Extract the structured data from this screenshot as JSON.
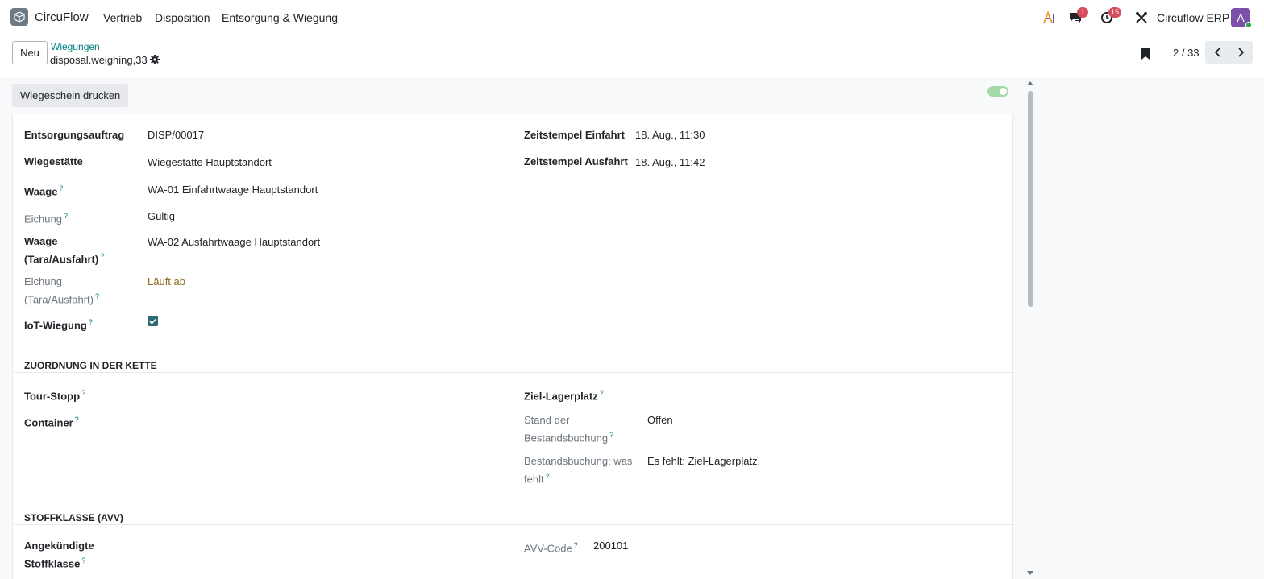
{
  "nav": {
    "app_name": "CircuFlow",
    "menu": [
      "Vertrieb",
      "Disposition",
      "Entsorgung & Wiegung"
    ],
    "messages_badge": "1",
    "activities_badge": "15",
    "company": "Circuflow ERP",
    "avatar_letter": "A"
  },
  "control": {
    "new_label": "Neu",
    "breadcrumb_parent": "Wiegungen",
    "breadcrumb_current": "disposal.weighing,33",
    "pager": "2 / 33"
  },
  "statusbar": {
    "print_label": "Wiegeschein drucken"
  },
  "form": {
    "left": [
      {
        "label": "Entsorgungsauftrag",
        "value": "DISP/00017"
      },
      {
        "label": "Wiegestätte",
        "value": "Wiegestätte Hauptstandort"
      },
      {
        "label": "Waage",
        "value": "WA-01 Einfahrtwaage Hauptstandort"
      },
      {
        "label": "Eichung",
        "value": "Gültig"
      },
      {
        "label_line1": "Waage",
        "label_line2": "(Tara/Ausfahrt)",
        "value": "WA-02 Ausfahrtwaage Hauptstandort"
      },
      {
        "label_line1": "Eichung",
        "label_line2": "(Tara/Ausfahrt)",
        "value": "Läuft ab"
      },
      {
        "label": "IoT-Wiegung"
      }
    ],
    "right": [
      {
        "label": "Zeitstempel Einfahrt",
        "value": "18. Aug., 11:30"
      },
      {
        "label": "Zeitstempel Ausfahrt",
        "value": "18. Aug., 11:42"
      }
    ]
  },
  "section_chain": {
    "title": "Zuordnung in der Kette",
    "tour_stop": "Tour-Stopp",
    "container": "Container",
    "target_location": "Ziel-Lagerplatz",
    "stock_state_line1": "Stand der",
    "stock_state_line2": "Bestandsbuchung",
    "stock_state_value": "Offen",
    "missing_line1": "Bestandsbuchung: was",
    "missing_line2": "fehlt",
    "missing_value": "Es fehlt: Ziel-Lagerplatz."
  },
  "section_avv": {
    "title": "Stoffklasse (AVV)",
    "announced_line1": "Angekündigte",
    "announced_line2": "Stoffklasse",
    "avv_label": "AVV-Code",
    "avv_value": "200101"
  },
  "help_mark": "?",
  "colors": {
    "accent": "#017e84",
    "badge": "#d44c59",
    "avatar": "#7b4fa8",
    "warning_text": "#8a6d1e",
    "checkbox": "#2f6b73",
    "toggle": "#a3d9a5"
  }
}
